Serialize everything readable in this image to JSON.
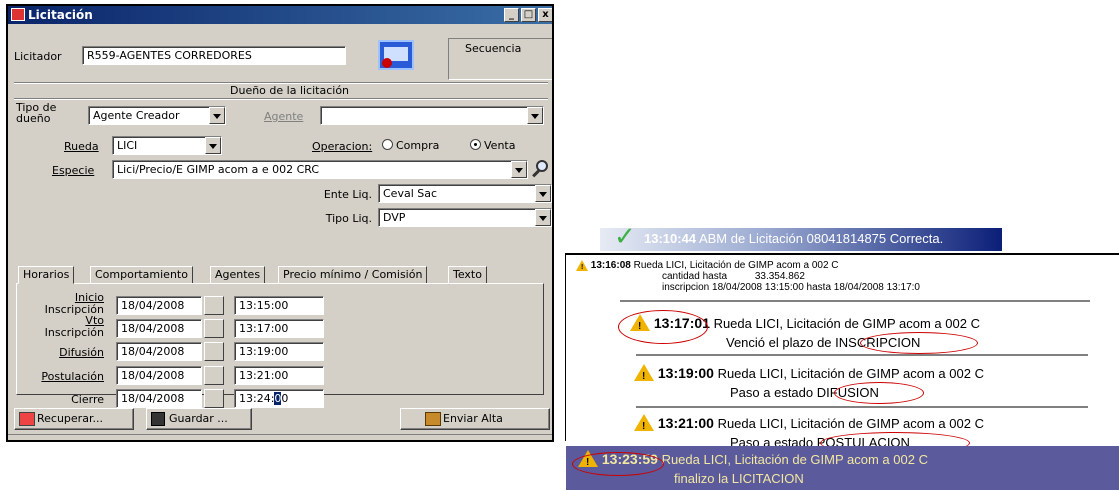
{
  "window": {
    "title": "Licitación",
    "controls": [
      "_",
      "□",
      "x"
    ]
  },
  "form": {
    "licitador_label": "Licitador",
    "licitador_value": "R559-AGENTES CORREDORES",
    "secuencia_label": "Secuencia",
    "dueno_group": "Dueño de la licitación",
    "tipo_dueno_label_1": "Tipo de",
    "tipo_dueno_label_2": "dueño",
    "tipo_dueno_value": "Agente Creador",
    "agente_label": "Agente",
    "agente_value": "",
    "rueda_label": "Rueda",
    "rueda_value": "LICI",
    "operacion_label": "Operacion:",
    "compra_label": "Compra",
    "venta_label": "Venta",
    "especie_label": "Especie",
    "especie_value": "Lici/Precio/E GIMP acom a e 002 CRC",
    "ente_liq_label": "Ente Liq.",
    "ente_liq_value": "Ceval Sac",
    "tipo_liq_label": "Tipo Liq.",
    "tipo_liq_value": "DVP"
  },
  "tabs": [
    "Horarios",
    "Comportamiento",
    "Agentes",
    "Precio mínimo / Comisión",
    "Texto"
  ],
  "horarios": {
    "inicio_1": "Inicio",
    "inicio_2": "Inscripción",
    "inicio_date": "18/04/2008",
    "inicio_time": "13:15:00",
    "vto_1": "Vto",
    "vto_2": "Inscripción",
    "vto_date": "18/04/2008",
    "vto_time": "13:17:00",
    "difusion_label": "Difusión",
    "difusion_date": "18/04/2008",
    "difusion_time": "13:19:00",
    "postulacion_label": "Postulación",
    "postulacion_date": "18/04/2008",
    "postulacion_time": "13:21:00",
    "cierre_label": "Cierre",
    "cierre_date": "18/04/2008",
    "cierre_time_a": "13:24:",
    "cierre_time_cursor": "0",
    "cierre_time_b": "0"
  },
  "buttons": {
    "recuperar": "Recuperar...",
    "guardar": "Guardar ...",
    "enviar": "Enviar Alta"
  },
  "log": {
    "success": {
      "time": "13:10:44",
      "text": "ABM de Licitación 08041814875 Correcta."
    },
    "alert": {
      "time": "13:16:08",
      "text": "Rueda LICI, Licitación de GIMP acom a 002 C",
      "line2": "cantidad hasta          33.354.862",
      "line3": "inscripcion 18/04/2008 13:15:00 hasta 18/04/2008 13:17:0"
    },
    "events": [
      {
        "time": "13:17:01",
        "text": "Rueda LICI, Licitación de GIMP acom a 002 C",
        "line2a": "Venció el plazo de",
        "line2b": "INSCRIPCION"
      },
      {
        "time": "13:19:00",
        "text": "Rueda LICI, Licitación de GIMP acom a 002 C",
        "line2a": "Paso a estado",
        "line2b": "DIFUSION"
      },
      {
        "time": "13:21:00",
        "text": "Rueda LICI, Licitación de GIMP acom a 002 C",
        "line2a": "Paso a estado",
        "line2b": "POSTULACION"
      }
    ],
    "final": {
      "time": "13:23:59",
      "text": "Rueda LICI, Licitación de GIMP acom a 002 C",
      "line2": "finalizo la LICITACION"
    }
  },
  "colors": {
    "titlebar": "#0a246a",
    "banner": "#0b1f78",
    "final_banner": "#5b5a9c",
    "highlight": "#cc0000",
    "success_check": "#3cb043"
  }
}
